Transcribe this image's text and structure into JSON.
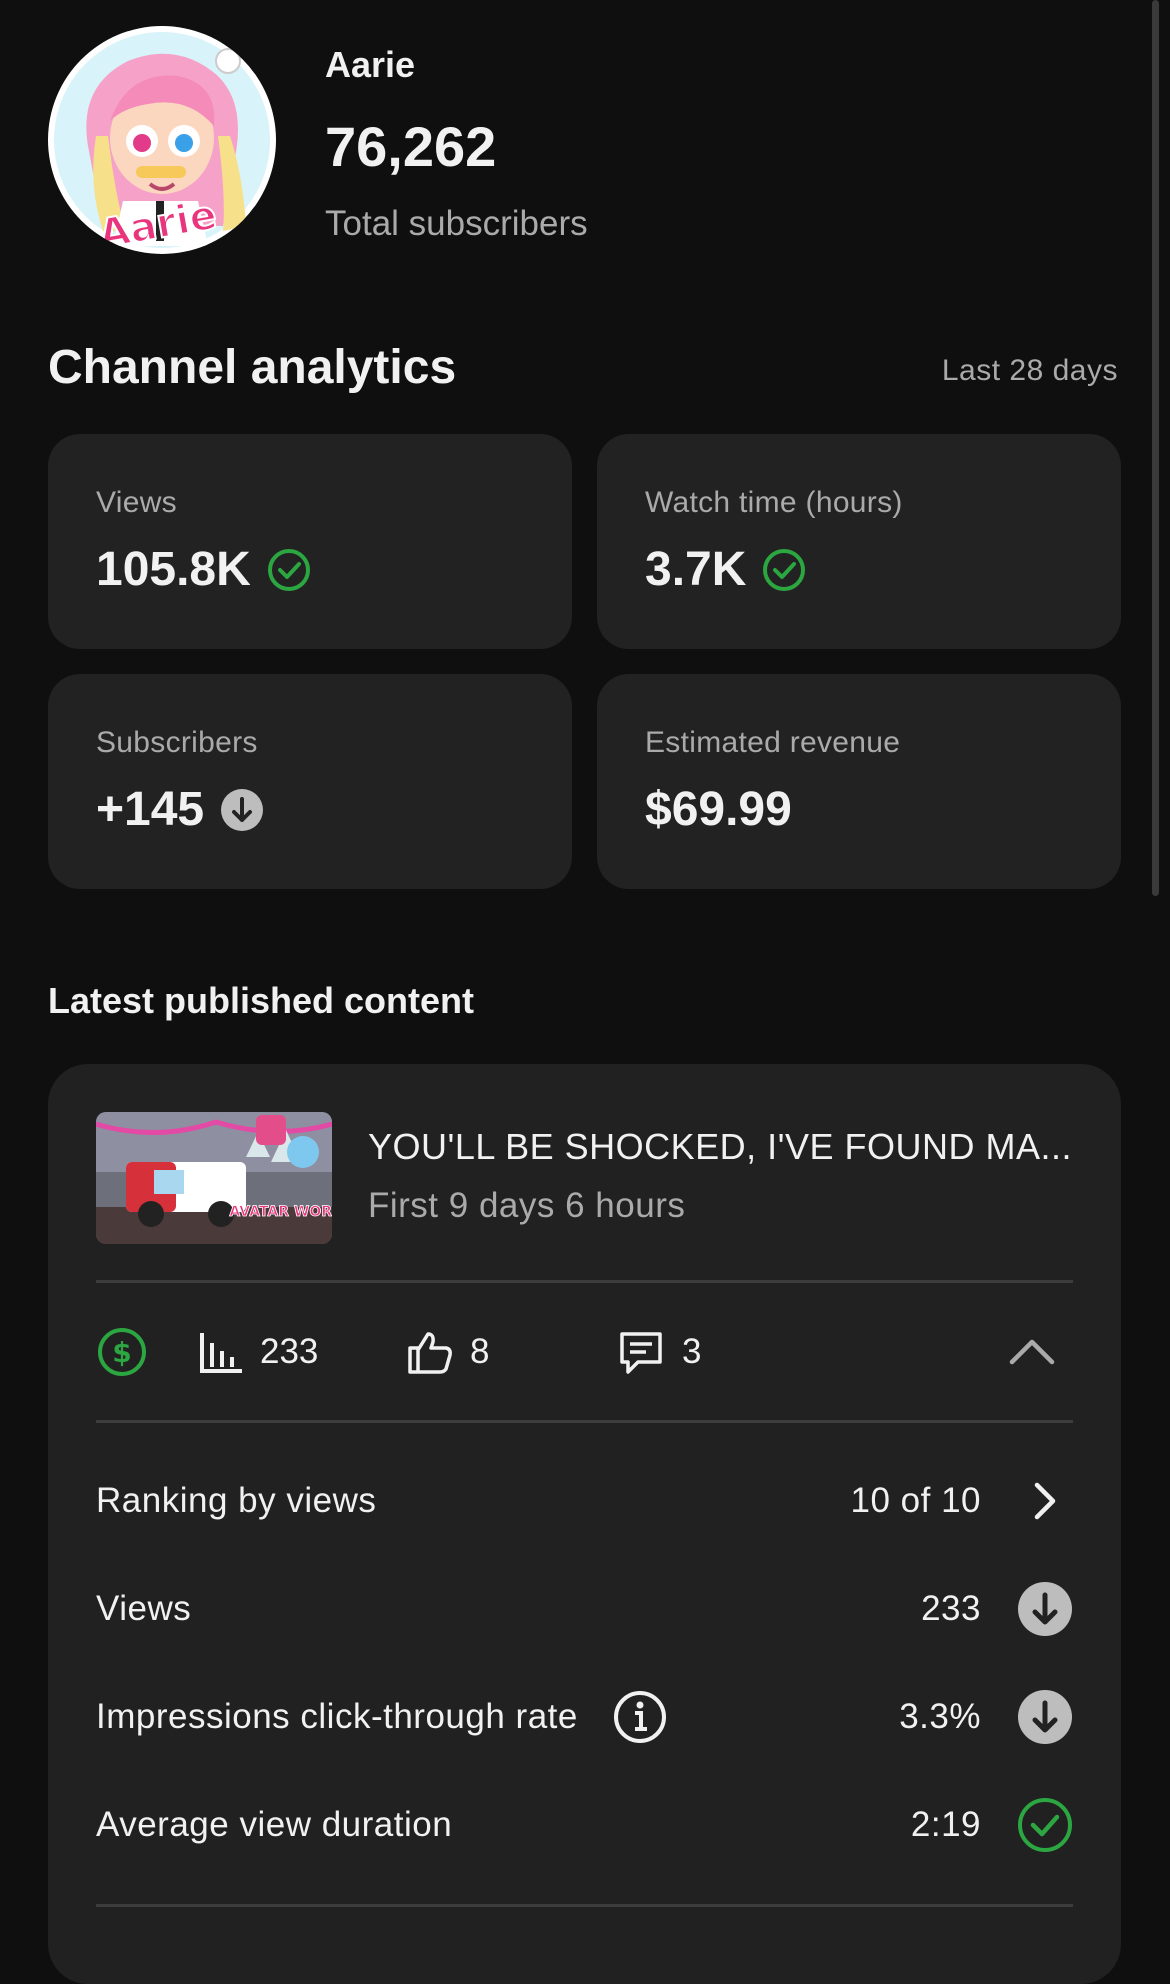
{
  "channel": {
    "name": "Aarie",
    "subscriber_count": "76,262",
    "subscriber_label": "Total subscribers",
    "avatar_text": "Aarie"
  },
  "analytics": {
    "title": "Channel analytics",
    "period": "Last 28 days",
    "cards": [
      {
        "label": "Views",
        "value": "105.8K",
        "status": "check"
      },
      {
        "label": "Watch time (hours)",
        "value": "3.7K",
        "status": "check"
      },
      {
        "label": "Subscribers",
        "value": "+145",
        "status": "down"
      },
      {
        "label": "Estimated revenue",
        "value": "$69.99",
        "status": "none"
      }
    ]
  },
  "latest": {
    "title": "Latest published content",
    "video": {
      "title": "YOU'LL BE SHOCKED, I'VE FOUND MA...",
      "subtitle": "First 9 days 6 hours",
      "thumb_text": "AVATAR WORLD"
    },
    "stats": {
      "views": "233",
      "likes": "8",
      "comments": "3"
    },
    "rows": [
      {
        "label": "Ranking by views",
        "value": "10 of 10",
        "icon": "chevron-right"
      },
      {
        "label": "Views",
        "value": "233",
        "icon": "down"
      },
      {
        "label": "Impressions click-through rate",
        "value": "3.3%",
        "icon": "down"
      },
      {
        "label": "Average view duration",
        "value": "2:19",
        "icon": "check"
      }
    ]
  },
  "colors": {
    "background": "#0f0f0f",
    "card": "#222222",
    "positive": "#2ba640",
    "neutral_badge": "#bdbdbd"
  }
}
